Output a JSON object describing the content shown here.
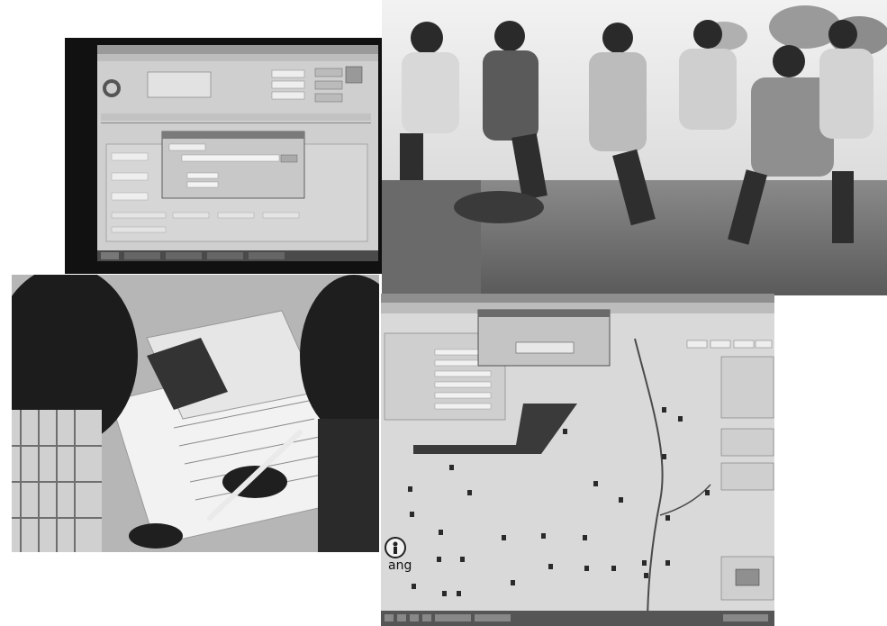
{
  "collage": {
    "panels": [
      {
        "id": "monitor-photo",
        "subject": "software-form-on-monitor"
      },
      {
        "id": "group-photo",
        "subject": "men-seated-outdoors"
      },
      {
        "id": "paperwork-photo",
        "subject": "people-writing-on-forms"
      },
      {
        "id": "map-screen-photo",
        "subject": "mapping-application-screen"
      }
    ]
  },
  "map_screen": {
    "corner_text": "ang"
  },
  "palette": {
    "background": "#ffffff",
    "photo_dark": "#1a1a1a",
    "screen_light": "#d9d9d9"
  }
}
